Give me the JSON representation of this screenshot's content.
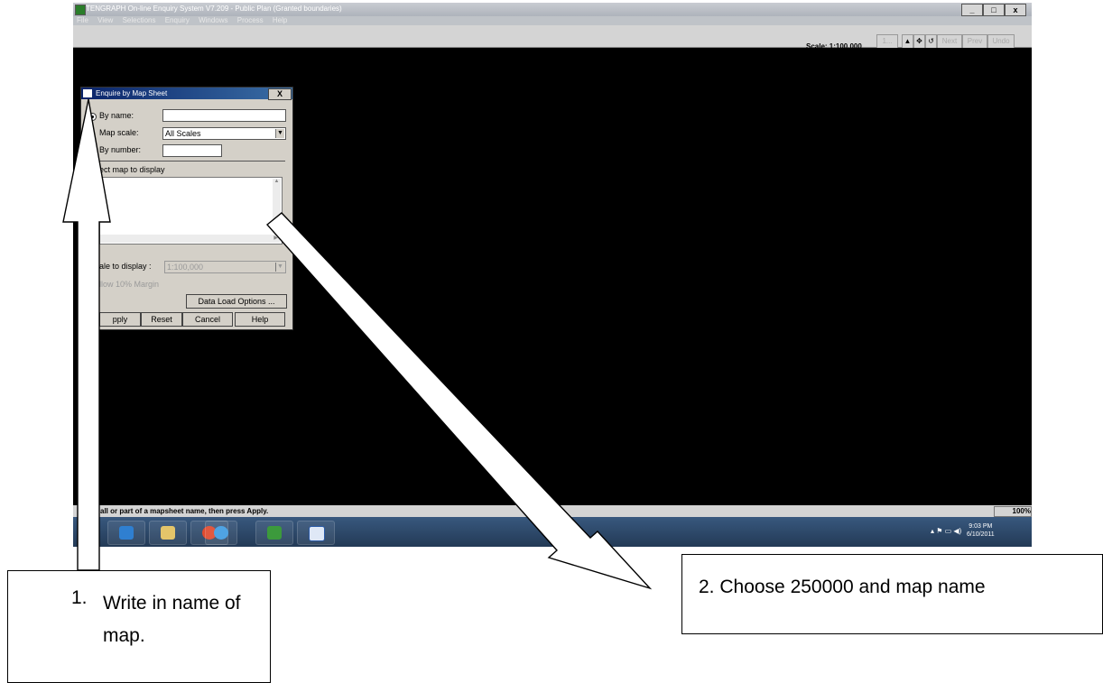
{
  "app": {
    "title": "TENGRAPH On-line Enquiry System V7.209 - Public Plan (Granted boundaries)",
    "menu": [
      "File",
      "View",
      "Selections",
      "Enquiry",
      "Windows",
      "Process",
      "Help"
    ],
    "window_buttons": {
      "minimize": "_",
      "restore": "т",
      "close": "x"
    },
    "toolbar": {
      "scale_readout": "Scale: 1:100,000",
      "buttons": {
        "ellipsis": "1...",
        "pointer": "▲",
        "pan": "✥",
        "refresh": "↺",
        "next": "Next",
        "prev": "Prev",
        "undo": "Undo"
      }
    },
    "status_text": "all or part of a mapsheet name, then press Apply.",
    "zoom": "100%",
    "clock_time": "9:03 PM",
    "clock_date": "6/10/2011"
  },
  "dialog": {
    "title": "Enquire by Map Sheet",
    "close": "X",
    "by_name_label": "By name:",
    "by_name_value": "",
    "map_scale_label": "Map scale:",
    "map_scale_value": "All Scales",
    "by_number_label": "By number:",
    "by_number_value": "",
    "list_label": "ect map to display",
    "scale_to_display_label": "ale to display :",
    "scale_to_display_value": "1:100,000",
    "allow_margin_label": "llow 10% Margin",
    "data_load_options": "Data Load Options ...",
    "buttons": {
      "apply": "pply",
      "reset": "Reset",
      "cancel": "Cancel",
      "help": "Help"
    }
  },
  "callouts": {
    "c1_number": "1.",
    "c1_text": "Write in name of map.",
    "c2_text": "2. Choose 250000 and map name"
  },
  "colors": {
    "title_bar_start": "#0a246a",
    "title_bar_end": "#3a6ea5",
    "map_canvas": "#000000",
    "taskbar": "#2b4567"
  }
}
